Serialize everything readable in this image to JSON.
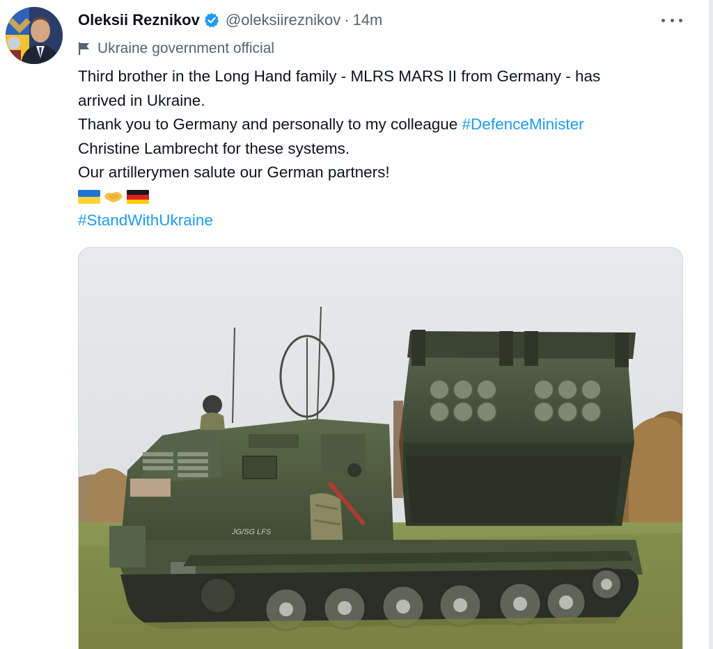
{
  "author": {
    "name": "Oleksii Reznikov",
    "handle": "@oleksiireznikov",
    "separator": "·",
    "time": "14m",
    "label": "Ukraine government official"
  },
  "tweet": {
    "lines": [
      "Third brother in the Long Hand family - MLRS MARS II from Germany - has",
      "arrived in Ukraine.",
      "Thank you to Germany and personally to my colleague "
    ],
    "hashtag_inline": "#DefenceMinister",
    "lines_after": [
      "Christine Lambrecht for these systems.",
      "Our artillerymen salute our German partners!"
    ],
    "emojis": [
      "ukraine-flag",
      "handshake",
      "germany-flag"
    ],
    "hashtag_footer": "#StandWithUkraine",
    "vehicle_marking": "JG/SG LFS"
  },
  "icons": {
    "verified": "verified-badge-icon",
    "more": "more-options-icon",
    "government": "flag-icon"
  },
  "colors": {
    "link": "#1d9bf0",
    "secondary_text": "#536471",
    "verified": "#1d9bf0",
    "vehicle": "#4b5a3e"
  }
}
